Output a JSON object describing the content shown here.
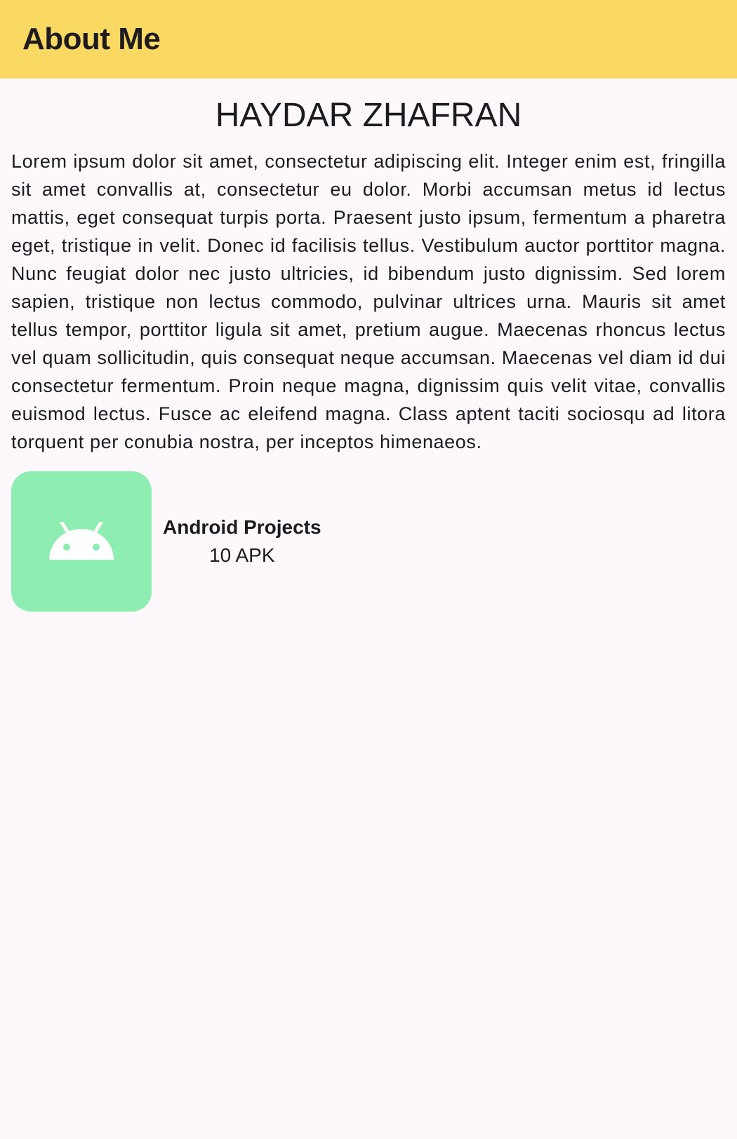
{
  "app_bar": {
    "title": "About Me",
    "color": "#f9d961"
  },
  "profile": {
    "name": "HAYDAR ZHAFRAN",
    "bio": "Lorem ipsum dolor sit amet, consectetur adipiscing elit. Integer enim est, fringilla sit amet convallis at, consectetur eu dolor. Morbi accumsan metus id lectus mattis, eget consequat turpis porta. Praesent justo ipsum, fermentum a pharetra eget, tristique in velit. Donec id facilisis tellus. Vestibulum auctor porttitor magna. Nunc feugiat dolor nec justo ultricies, id bibendum justo dignissim. Sed lorem sapien, tristique non lectus commodo, pulvinar ultrices urna. Mauris sit amet tellus tempor, porttitor ligula sit amet, pretium augue. Maecenas rhoncus lectus vel quam sollicitudin, quis consequat neque accumsan. Maecenas vel diam id dui consectetur fermentum. Proin neque magna, dignissim quis velit vitae, convallis euismod lectus. Fusce ac eleifend magna. Class aptent taciti sociosqu ad litora torquent per conubia nostra, per inceptos himenaeos."
  },
  "projects": {
    "icon": "android-icon",
    "icon_background": "#8eeeb2",
    "title": "Android Projects",
    "count": "10 APK"
  }
}
